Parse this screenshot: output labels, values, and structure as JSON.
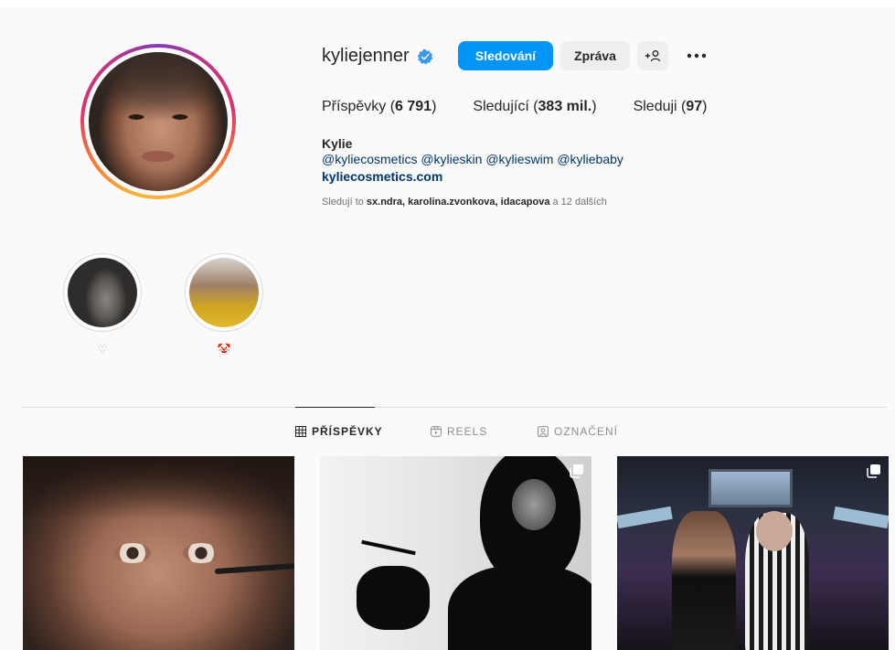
{
  "profile": {
    "username": "kyliejenner",
    "verified": true,
    "buttons": {
      "follow_label": "Sledování",
      "message_label": "Zpráva",
      "add_label": "+♂"
    },
    "stats": {
      "posts_prefix": "Příspěvky (",
      "posts_count": "6 791",
      "followers_prefix": "Sledující (",
      "followers_count": "383 mil.",
      "following_prefix": "Sleduji (",
      "following_count": "97",
      "close_paren": ")"
    },
    "bio": {
      "name": "Kylie",
      "tags": "@kyliecosmetics @kylieskin @kylieswim @kyliebaby",
      "link": "kyliecosmetics.com"
    },
    "followed_by": {
      "prefix": "Sledují to ",
      "names": "sx.ndra, karolina.zvonkova, idacapova",
      "suffix": " a 12 dalších"
    }
  },
  "highlights": [
    {
      "label": "♡"
    },
    {
      "label": "🤡"
    }
  ],
  "tabs": [
    {
      "label": "PŘÍSPĚVKY",
      "icon": "grid-icon",
      "active": true
    },
    {
      "label": "REELS",
      "icon": "reels-icon",
      "active": false
    },
    {
      "label": "OZNAČENÍ",
      "icon": "tagged-icon",
      "active": false
    }
  ],
  "colors": {
    "accent": "#0095f6",
    "link": "#00376b",
    "background": "#fafafa"
  }
}
